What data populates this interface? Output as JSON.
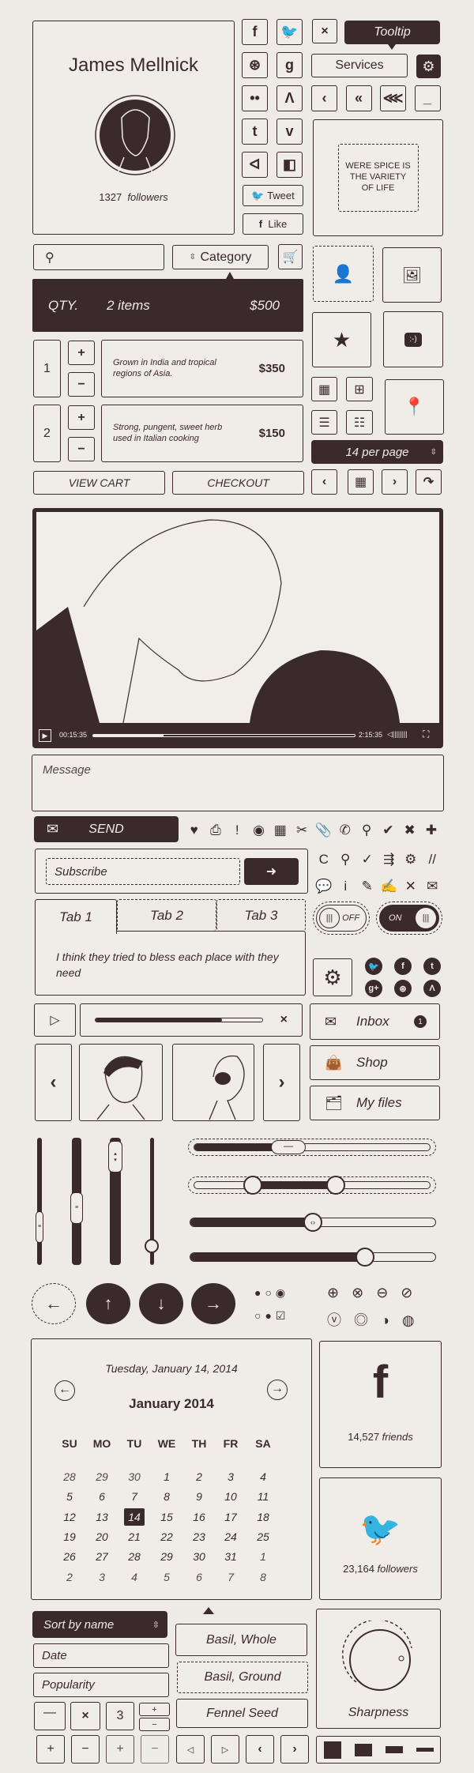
{
  "colors": {
    "background": "#eeeae6",
    "dark": "#3b2a2b"
  },
  "profile": {
    "name": "James Mellnick",
    "followers_count": "1327",
    "followers_label": "followers"
  },
  "social_buttons": [
    "facebook-icon",
    "twitter-icon",
    "dribbble-icon",
    "google-icon",
    "flickr-icon",
    "forrst-icon",
    "tumblr-icon",
    "vimeo-icon",
    "deviantart-icon",
    "delicious-icon"
  ],
  "social_glyphs": {
    "f": "f",
    "twitter": "🐦",
    "dribbble": "⊛",
    "g": "g",
    "flickr": "••",
    "forrst": "Λ",
    "t": "t",
    "v": "v",
    "deviantart": "ᐊ",
    "delicious": "◧"
  },
  "tweet_label": "Tweet",
  "like_label": "Like",
  "tooltip": {
    "text": "Tooltip",
    "target": "Services"
  },
  "close_label": "×",
  "nav_arrows": [
    "‹",
    "«",
    "⋘",
    "_"
  ],
  "quote": "WERE SPICE IS THE VARIETY OF LIFE",
  "search": {
    "placeholder": ""
  },
  "category_label": "Category",
  "cart_summary": {
    "qty_label": "QTY.",
    "items": "2 items",
    "total": "$500"
  },
  "cart_items": [
    {
      "qty": "1",
      "desc": "Grown in India and tropical regions of Asia.",
      "price": "$350"
    },
    {
      "qty": "2",
      "desc": "Strong, pungent, sweet herb used in Italian cooking",
      "price": "$150"
    }
  ],
  "per_page": "14 per page",
  "view_cart": "VIEW CART",
  "checkout": "CHECKOUT",
  "video": {
    "current_time": "00:15:35",
    "duration": "2:15:35",
    "progress": 0.27
  },
  "message_placeholder": "Message",
  "send_label": "SEND",
  "icons_row1": [
    "♥",
    "⎙",
    "!",
    "◉",
    "▦",
    "✂",
    "📎",
    "✆",
    "⚲",
    "✔",
    "✖",
    "✚"
  ],
  "icons_row2": [
    "C",
    "⚲",
    "✓",
    "⇶",
    "⚙",
    "//"
  ],
  "icons_row3": [
    "💬",
    "i",
    "✎",
    "✍",
    "✕",
    "✉"
  ],
  "subscribe_placeholder": "Subscribe",
  "tabs": {
    "items": [
      "Tab 1",
      "Tab 2",
      "Tab 3"
    ],
    "active": 0,
    "content": "I think they tried to bless each place with they need"
  },
  "toggles": {
    "off_label": "OFF",
    "on_label": "ON"
  },
  "round_social": [
    "twitter",
    "f",
    "t",
    "g+",
    "dribbble",
    "forrst"
  ],
  "audio": {
    "progress": 0.76,
    "close": "×"
  },
  "menu": [
    {
      "label": "Inbox",
      "badge": "1"
    },
    {
      "label": "Shop"
    },
    {
      "label": "My files"
    }
  ],
  "vertical_sliders": [
    0.3,
    0.45,
    0.85,
    0.15
  ],
  "horizontal_sliders": {
    "single": 0.4,
    "range": [
      0.25,
      0.6
    ],
    "s3": 0.5,
    "s4": 0.71
  },
  "calendar": {
    "full_date": "Tuesday, January 14, 2014",
    "month": "January 2014",
    "weekdays": [
      "SU",
      "MO",
      "TU",
      "WE",
      "TH",
      "FR",
      "SA"
    ],
    "weeks": [
      [
        "28",
        "29",
        "30",
        "1",
        "2",
        "3",
        "4"
      ],
      [
        "5",
        "6",
        "7",
        "8",
        "9",
        "10",
        "11"
      ],
      [
        "12",
        "13",
        "14",
        "15",
        "16",
        "17",
        "18"
      ],
      [
        "19",
        "20",
        "21",
        "22",
        "23",
        "24",
        "25"
      ],
      [
        "26",
        "27",
        "28",
        "29",
        "30",
        "31",
        "1"
      ],
      [
        "2",
        "3",
        "4",
        "5",
        "6",
        "7",
        "8"
      ]
    ],
    "selected": "14"
  },
  "facebook": {
    "count": "14,527",
    "label": "friends"
  },
  "twitter": {
    "count": "23,164",
    "label": "followers"
  },
  "sort": {
    "selected": "Sort by name",
    "options": [
      "Date",
      "Popularity"
    ]
  },
  "stepper_value": "3",
  "dropdown": [
    "Basil, Whole",
    "Basil, Ground",
    "Fennel Seed"
  ],
  "knob": {
    "label": "Sharpness"
  }
}
